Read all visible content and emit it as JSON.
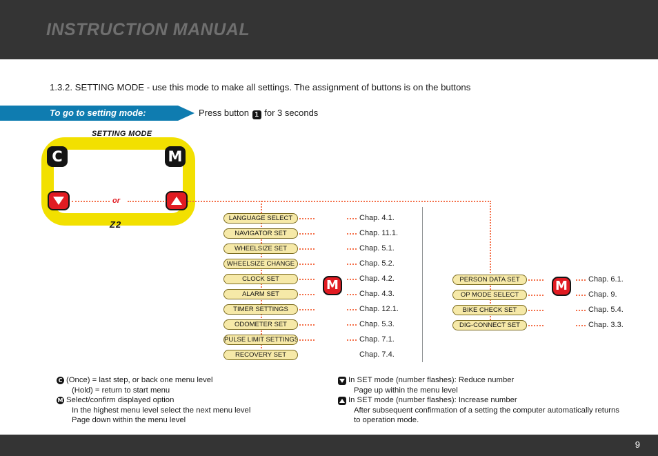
{
  "header": {
    "title": "INSTRUCTION MANUAL",
    "bar_color": "#343434",
    "title_color": "#6f6f6f"
  },
  "intro": {
    "text": "1.3.2. SETTING MODE - use this mode to make all settings. The assignment of buttons is on the buttons"
  },
  "banner": {
    "label": "To go to setting mode:",
    "color": "#0f7cb0",
    "note_before": "Press button",
    "button_glyph": "1",
    "note_after": "for 3 seconds"
  },
  "device": {
    "title": "SETTING MODE",
    "model": "Z2",
    "or_label": "or",
    "frame_color": "#f2e000",
    "keys": {
      "c": "C",
      "m": "M",
      "down": "down-triangle",
      "up": "up-triangle"
    }
  },
  "menu_primary": {
    "badge": "M",
    "items": [
      {
        "label": "LANGUAGE SELECT",
        "chapter": "Chap. 4.1."
      },
      {
        "label": "NAVIGATOR SET",
        "chapter": "Chap. 11.1."
      },
      {
        "label": "WHEELSIZE SET",
        "chapter": "Chap. 5.1."
      },
      {
        "label": "WHEELSIZE CHANGE",
        "chapter": "Chap. 5.2."
      },
      {
        "label": "CLOCK SET",
        "chapter": "Chap. 4.2."
      },
      {
        "label": "ALARM SET",
        "chapter": "Chap. 4.3."
      },
      {
        "label": "TIMER SETTINGS",
        "chapter": "Chap. 12.1."
      },
      {
        "label": "ODOMETER SET",
        "chapter": "Chap. 5.3."
      },
      {
        "label": "PULSE LIMIT SETTINGS",
        "chapter": "Chap. 7.1."
      },
      {
        "label": "RECOVERY SET",
        "chapter": "Chap. 7.4."
      }
    ]
  },
  "menu_secondary": {
    "badge": "M",
    "items": [
      {
        "label": "PERSON DATA SET",
        "chapter": "Chap. 6.1."
      },
      {
        "label": "OP MODE SELECT",
        "chapter": "Chap. 9."
      },
      {
        "label": "BIKE CHECK SET",
        "chapter": "Chap. 5.4."
      },
      {
        "label": "DIG-CONNECT SET",
        "chapter": "Chap. 3.3."
      }
    ]
  },
  "legend": {
    "left": [
      {
        "icon": "c-button-icon",
        "lines": [
          "(Once) = last step, or back one menu level",
          "(Hold) = return to start menu"
        ]
      },
      {
        "icon": "m-button-icon",
        "lines": [
          "Select/confirm displayed option",
          "In the highest menu level select the next menu level",
          "Page down within the menu level"
        ]
      }
    ],
    "right": [
      {
        "icon": "down-button-icon",
        "lines": [
          "In SET mode (number flashes): Reduce number",
          "Page up within the menu level"
        ]
      },
      {
        "icon": "up-button-icon",
        "lines": [
          "In SET mode (number flashes): Increase number",
          "After subsequent confirmation of a setting the computer automatically returns",
          "to operation mode."
        ]
      }
    ]
  },
  "footer": {
    "page_number": "9",
    "bar_color": "#343434"
  }
}
